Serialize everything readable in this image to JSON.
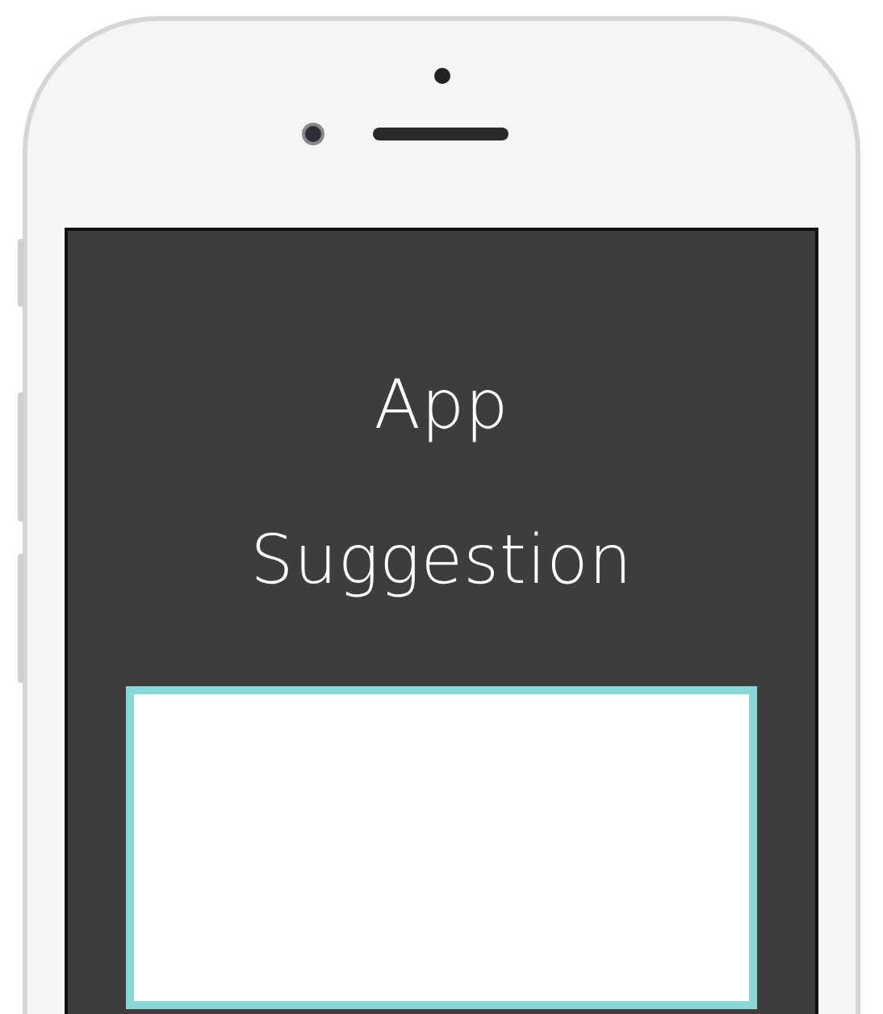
{
  "screen": {
    "heading": "App Suggestion"
  }
}
